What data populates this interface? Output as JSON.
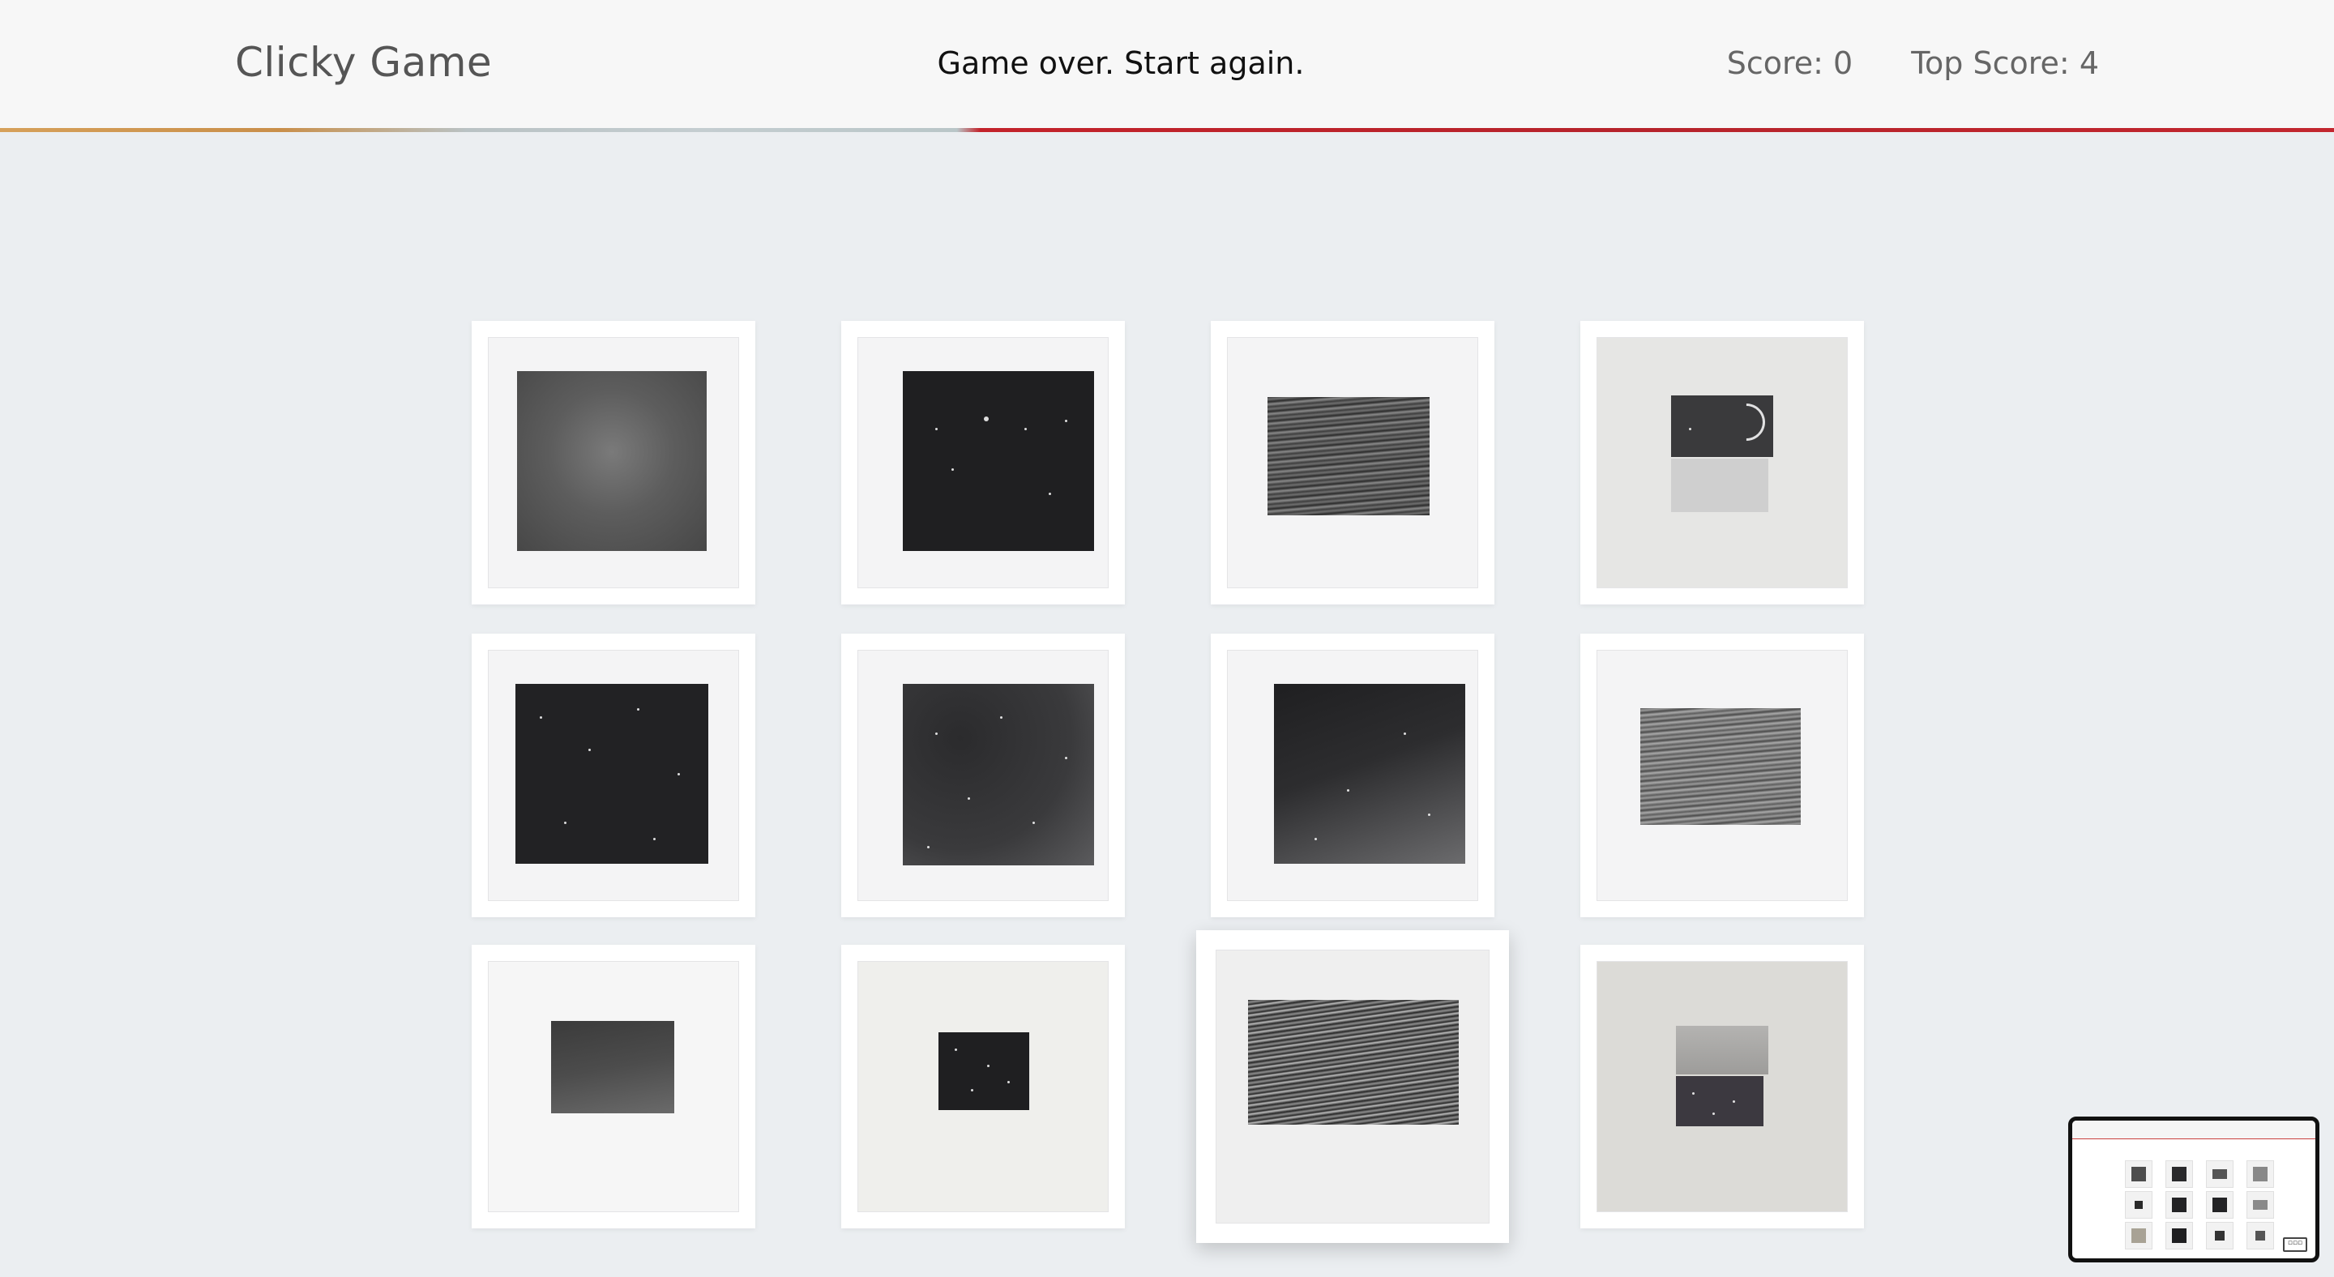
{
  "header": {
    "brand": "Clicky Game",
    "message": "Game over. Start again.",
    "score": "Score: 0",
    "top_score": "Top Score: 4"
  },
  "colors": {
    "background": "#ebeef1",
    "navbar": "#f7f7f7",
    "stripe_left": "#d6a05a",
    "stripe_mid": "#c4cdd0",
    "stripe_right": "#c3222a"
  },
  "cards": [
    {
      "name": "card-starfield-grey",
      "art": "stars-grey"
    },
    {
      "name": "card-starfield-black",
      "art": "stars-black"
    },
    {
      "name": "card-ocean-wide",
      "art": "ocean"
    },
    {
      "name": "card-moon-diptych",
      "art": "moon-diptych"
    },
    {
      "name": "card-starfield-dense",
      "art": "stars-deep"
    },
    {
      "name": "card-starfield-foggy",
      "art": "stars-foggy"
    },
    {
      "name": "card-starfield-diagonal",
      "art": "stars-diag"
    },
    {
      "name": "card-ocean-light",
      "art": "ocean-light"
    },
    {
      "name": "card-small-smoke",
      "art": "smoke"
    },
    {
      "name": "card-small-stars",
      "art": "stars-small"
    },
    {
      "name": "card-ocean-dark",
      "art": "ocean-dark",
      "hovered": true
    },
    {
      "name": "card-ship-diptych",
      "art": "ship-diptych"
    }
  ]
}
